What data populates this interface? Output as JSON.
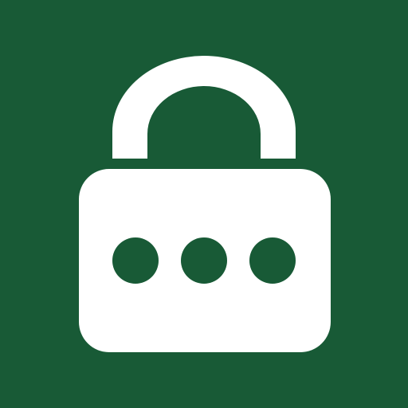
{
  "icon": {
    "name": "lock-password-icon",
    "background_color": "#185a36",
    "foreground_color": "#ffffff",
    "dot_count": 3
  }
}
